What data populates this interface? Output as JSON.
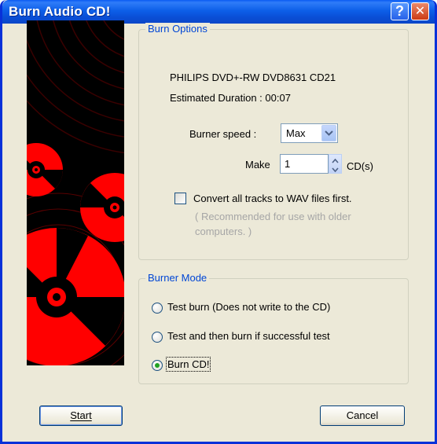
{
  "window": {
    "title": "Burn Audio CD!",
    "help_glyph": "?",
    "close_glyph": "✕"
  },
  "burn_options": {
    "legend": "Burn Options",
    "device": "PHILIPS DVD+-RW DVD8631 CD21",
    "estimated_duration": "Estimated Duration : 00:07",
    "speed_label": "Burner speed :",
    "speed_value": "Max",
    "make_label": "Make",
    "make_value": "1",
    "make_unit": "CD(s)",
    "convert_label": "Convert all tracks to WAV files first.",
    "convert_checked": false,
    "recommend_line1": "( Recommended for use with older",
    "recommend_line2": "computers. )"
  },
  "burner_mode": {
    "legend": "Burner Mode",
    "options": [
      {
        "label": "Test burn  (Does not write to the CD)",
        "selected": false
      },
      {
        "label": "Test and then burn if successful test",
        "selected": false
      },
      {
        "label": "Burn CD!",
        "selected": true
      }
    ]
  },
  "buttons": {
    "start": "Start",
    "cancel": "Cancel"
  },
  "colors": {
    "title_bar": "#0a5bf2",
    "legend": "#0046d5",
    "art_red": "#ff0000",
    "art_black": "#000000"
  }
}
